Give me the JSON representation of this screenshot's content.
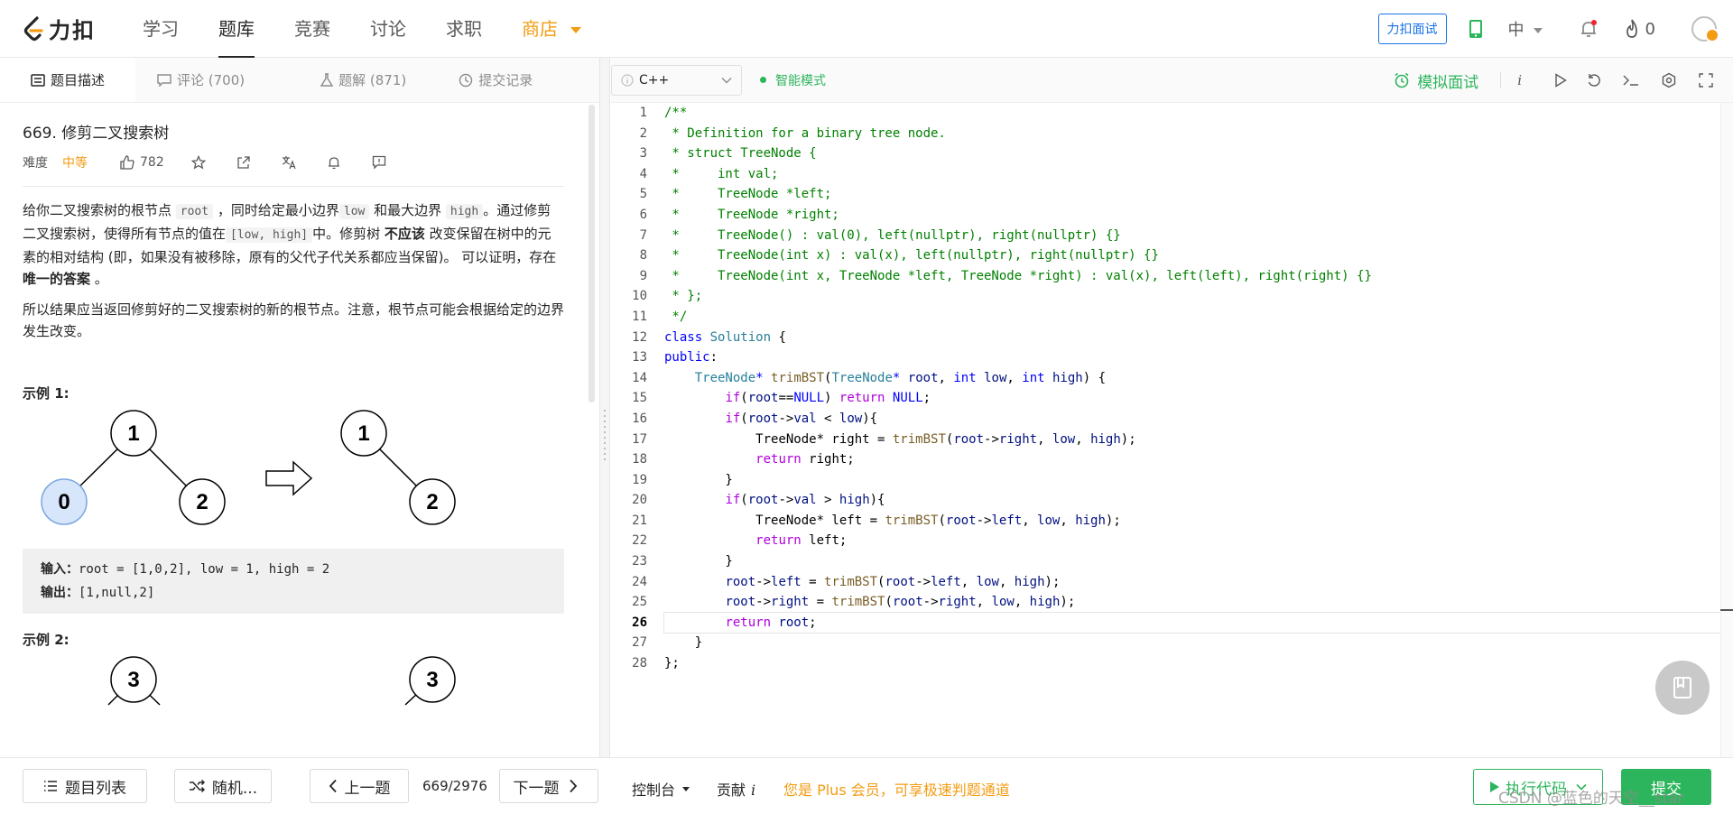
{
  "nav": {
    "logo_text": "力扣",
    "items": [
      "学习",
      "题库",
      "竞赛",
      "讨论",
      "求职",
      "商店"
    ],
    "interview_button": "力扣面试",
    "lang": "中",
    "fire_count": "0"
  },
  "left_tabs": [
    "题目描述",
    "评论 (700)",
    "题解 (871)",
    "提交记录"
  ],
  "problem": {
    "title": "669. 修剪二叉搜索树",
    "difficulty_label": "难度",
    "difficulty": "中等",
    "likes": "782",
    "desc1_a": "给你二叉搜索树的根节点 ",
    "desc1_code_root": "root",
    "desc1_b": " ，同时给定最小边界",
    "desc1_code_low": "low",
    "desc1_c": " 和最大边界 ",
    "desc1_code_high": "high",
    "desc1_d": "。通过修剪二叉搜索树，使得所有节点的值在",
    "desc1_code_range": "[low, high]",
    "desc1_e": "中。修剪树 ",
    "desc1_bold1": "不应该",
    "desc1_f": " 改变保留在树中的元素的相对结构 (即，如果没有被移除，原有的父代子代关系都应当保留)。 可以证明，存在 ",
    "desc1_bold2": "唯一的答案",
    "desc1_g": " 。",
    "desc2": "所以结果应当返回修剪好的二叉搜索树的新的根节点。注意，根节点可能会根据给定的边界发生改变。",
    "example1_heading": "示例 1:",
    "example1_input_label": "输入：",
    "example1_input": "root = [1,0,2], low = 1, high = 2",
    "example1_output_label": "输出：",
    "example1_output": "[1,null,2]",
    "example2_heading": "示例 2:",
    "tree1_before": [
      "1",
      "0",
      "2"
    ],
    "tree1_after": [
      "1",
      "2"
    ],
    "tree2_before_root": "3",
    "tree2_after_root": "3"
  },
  "editor": {
    "language": "C++",
    "smart_mode": "智能模式",
    "mock_interview": "模拟面试",
    "current_line": 26,
    "lines": [
      [
        [
          "c-comment",
          "/**"
        ]
      ],
      [
        [
          "c-comment",
          " * Definition for a binary tree node."
        ]
      ],
      [
        [
          "c-comment",
          " * struct TreeNode {"
        ]
      ],
      [
        [
          "c-comment",
          " *     int val;"
        ]
      ],
      [
        [
          "c-comment",
          " *     TreeNode *left;"
        ]
      ],
      [
        [
          "c-comment",
          " *     TreeNode *right;"
        ]
      ],
      [
        [
          "c-comment",
          " *     TreeNode() : val(0), left(nullptr), right(nullptr) {}"
        ]
      ],
      [
        [
          "c-comment",
          " *     TreeNode(int x) : val(x), left(nullptr), right(nullptr) {}"
        ]
      ],
      [
        [
          "c-comment",
          " *     TreeNode(int x, TreeNode *left, TreeNode *right) : val(x), left(left), right(right) {}"
        ]
      ],
      [
        [
          "c-comment",
          " * };"
        ]
      ],
      [
        [
          "c-comment",
          " */"
        ]
      ],
      [
        [
          "c-kw",
          "class"
        ],
        [
          "c-plain",
          " "
        ],
        [
          "c-type",
          "Solution"
        ],
        [
          "c-plain",
          " {"
        ]
      ],
      [
        [
          "c-kw",
          "public"
        ],
        [
          "c-plain",
          ":"
        ]
      ],
      [
        [
          "c-plain",
          "    "
        ],
        [
          "c-type",
          "TreeNode"
        ],
        [
          "c-kw",
          "*"
        ],
        [
          "c-plain",
          " "
        ],
        [
          "c-fn",
          "trimBST"
        ],
        [
          "c-plain",
          "("
        ],
        [
          "c-type",
          "TreeNode"
        ],
        [
          "c-kw",
          "*"
        ],
        [
          "c-plain",
          " "
        ],
        [
          "c-var",
          "root"
        ],
        [
          "c-plain",
          ", "
        ],
        [
          "c-kw",
          "int"
        ],
        [
          "c-plain",
          " "
        ],
        [
          "c-var",
          "low"
        ],
        [
          "c-plain",
          ", "
        ],
        [
          "c-kw",
          "int"
        ],
        [
          "c-plain",
          " "
        ],
        [
          "c-var",
          "high"
        ],
        [
          "c-plain",
          ") {"
        ]
      ],
      [
        [
          "c-plain",
          "        "
        ],
        [
          "c-ctrl",
          "if"
        ],
        [
          "c-plain",
          "("
        ],
        [
          "c-var",
          "root"
        ],
        [
          "c-plain",
          "=="
        ],
        [
          "c-kw",
          "NULL"
        ],
        [
          "c-plain",
          ") "
        ],
        [
          "c-ctrl",
          "return"
        ],
        [
          "c-plain",
          " "
        ],
        [
          "c-kw",
          "NULL"
        ],
        [
          "c-plain",
          ";"
        ]
      ],
      [
        [
          "c-plain",
          "        "
        ],
        [
          "c-ctrl",
          "if"
        ],
        [
          "c-plain",
          "("
        ],
        [
          "c-var",
          "root"
        ],
        [
          "c-plain",
          "->"
        ],
        [
          "c-var",
          "val"
        ],
        [
          "c-plain",
          " < "
        ],
        [
          "c-var",
          "low"
        ],
        [
          "c-plain",
          "){"
        ]
      ],
      [
        [
          "c-plain",
          "            TreeNode* right = "
        ],
        [
          "c-fn",
          "trimBST"
        ],
        [
          "c-plain",
          "("
        ],
        [
          "c-var",
          "root"
        ],
        [
          "c-plain",
          "->"
        ],
        [
          "c-var",
          "right"
        ],
        [
          "c-plain",
          ", "
        ],
        [
          "c-var",
          "low"
        ],
        [
          "c-plain",
          ", "
        ],
        [
          "c-var",
          "high"
        ],
        [
          "c-plain",
          ");"
        ]
      ],
      [
        [
          "c-plain",
          "            "
        ],
        [
          "c-ctrl",
          "return"
        ],
        [
          "c-plain",
          " right;"
        ]
      ],
      [
        [
          "c-plain",
          "        }"
        ]
      ],
      [
        [
          "c-plain",
          "        "
        ],
        [
          "c-ctrl",
          "if"
        ],
        [
          "c-plain",
          "("
        ],
        [
          "c-var",
          "root"
        ],
        [
          "c-plain",
          "->"
        ],
        [
          "c-var",
          "val"
        ],
        [
          "c-plain",
          " > "
        ],
        [
          "c-var",
          "high"
        ],
        [
          "c-plain",
          "){"
        ]
      ],
      [
        [
          "c-plain",
          "            TreeNode* left = "
        ],
        [
          "c-fn",
          "trimBST"
        ],
        [
          "c-plain",
          "("
        ],
        [
          "c-var",
          "root"
        ],
        [
          "c-plain",
          "->"
        ],
        [
          "c-var",
          "left"
        ],
        [
          "c-plain",
          ", "
        ],
        [
          "c-var",
          "low"
        ],
        [
          "c-plain",
          ", "
        ],
        [
          "c-var",
          "high"
        ],
        [
          "c-plain",
          ");"
        ]
      ],
      [
        [
          "c-plain",
          "            "
        ],
        [
          "c-ctrl",
          "return"
        ],
        [
          "c-plain",
          " left;"
        ]
      ],
      [
        [
          "c-plain",
          "        }"
        ]
      ],
      [
        [
          "c-plain",
          "        "
        ],
        [
          "c-var",
          "root"
        ],
        [
          "c-plain",
          "->"
        ],
        [
          "c-var",
          "left"
        ],
        [
          "c-plain",
          " = "
        ],
        [
          "c-fn",
          "trimBST"
        ],
        [
          "c-plain",
          "("
        ],
        [
          "c-var",
          "root"
        ],
        [
          "c-plain",
          "->"
        ],
        [
          "c-var",
          "left"
        ],
        [
          "c-plain",
          ", "
        ],
        [
          "c-var",
          "low"
        ],
        [
          "c-plain",
          ", "
        ],
        [
          "c-var",
          "high"
        ],
        [
          "c-plain",
          ");"
        ]
      ],
      [
        [
          "c-plain",
          "        "
        ],
        [
          "c-var",
          "root"
        ],
        [
          "c-plain",
          "->"
        ],
        [
          "c-var",
          "right"
        ],
        [
          "c-plain",
          " = "
        ],
        [
          "c-fn",
          "trimBST"
        ],
        [
          "c-plain",
          "("
        ],
        [
          "c-var",
          "root"
        ],
        [
          "c-plain",
          "->"
        ],
        [
          "c-var",
          "right"
        ],
        [
          "c-plain",
          ", "
        ],
        [
          "c-var",
          "low"
        ],
        [
          "c-plain",
          ", "
        ],
        [
          "c-var",
          "high"
        ],
        [
          "c-plain",
          ");"
        ]
      ],
      [
        [
          "c-plain",
          "        "
        ],
        [
          "c-ctrl",
          "return"
        ],
        [
          "c-plain",
          " "
        ],
        [
          "c-var",
          "root"
        ],
        [
          "c-plain",
          ";"
        ]
      ],
      [
        [
          "c-plain",
          "    }"
        ]
      ],
      [
        [
          "c-plain",
          "};"
        ]
      ]
    ]
  },
  "bottom": {
    "problem_list": "题目列表",
    "random": "随机...",
    "prev": "上一题",
    "pager": "669/2976",
    "next": "下一题",
    "console": "控制台",
    "contribute": "贡献",
    "contribute_icon": "i",
    "plus_note": "您是 Plus 会员，可享极速判题通道",
    "run": "执行代码",
    "submit": "提交",
    "watermark": "CSDN @蓝色的天空__star"
  },
  "colors": {
    "accent_green": "#2db55d",
    "accent_orange": "#f39c12",
    "brand_blue": "#1a73e8"
  }
}
